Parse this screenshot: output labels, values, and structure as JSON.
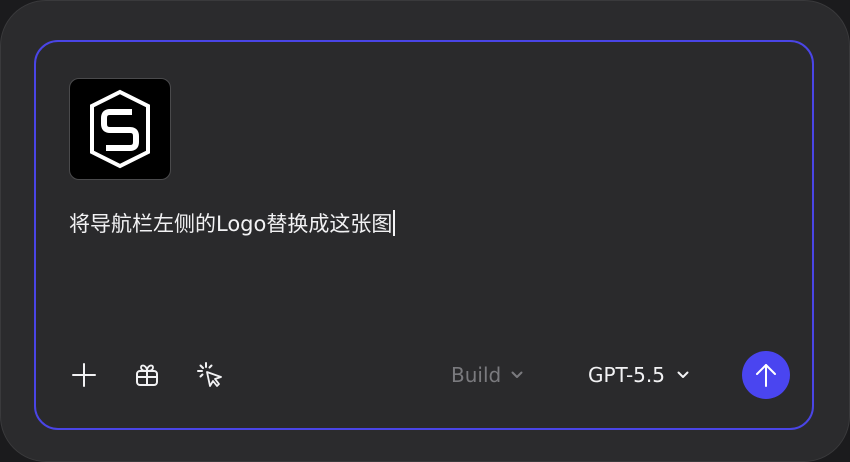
{
  "composer": {
    "attachment": {
      "alt_icon": "s-hexagon-logo"
    },
    "prompt_text": "将导航栏左侧的Logo替换成这张图",
    "toolbar": {
      "add_icon": "plus-icon",
      "template_icon": "gift-icon",
      "select_icon": "pointer-click-icon",
      "mode_label": "Build",
      "model_label": "GPT-5.5",
      "send_icon": "arrow-up-icon"
    }
  },
  "colors": {
    "accent": "#4a45f0",
    "border_accent": "#4a45e6",
    "background": "#2b2b2d",
    "text": "#f2f2f4",
    "muted_text": "#7a7a7e"
  }
}
